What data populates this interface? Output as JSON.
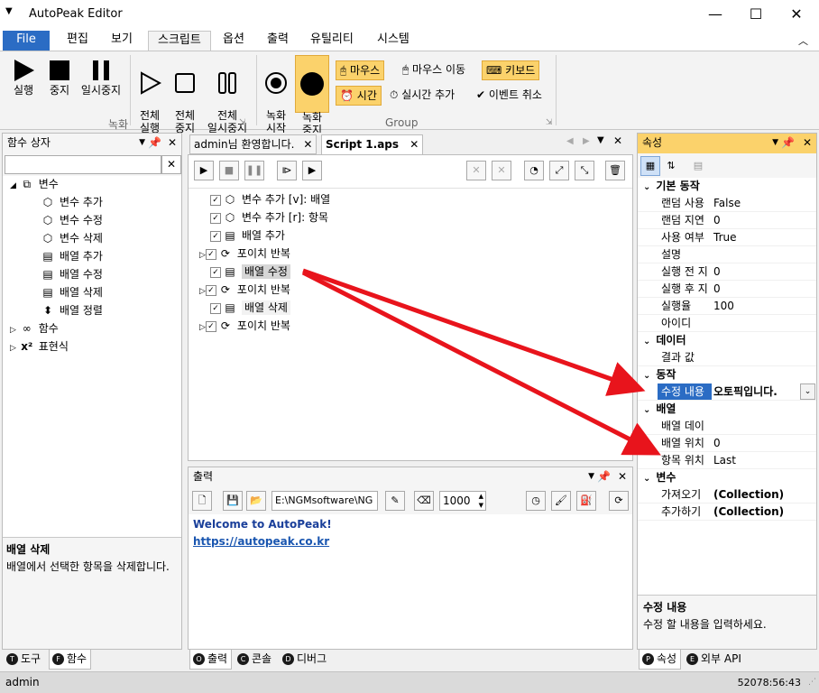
{
  "app": {
    "title": "AutoPeak Editor"
  },
  "menu": {
    "file": "File",
    "tabs": [
      "편집",
      "보기",
      "스크립트",
      "옵션",
      "출력",
      "유틸리티",
      "시스템"
    ]
  },
  "ribbon": {
    "run": "실행",
    "stop": "중지",
    "pause": "일시중지",
    "run_all": "전체\n실행",
    "stop_all": "전체\n중지",
    "pause_all": "전체\n일시중지",
    "rec_start": "녹화\n시작",
    "rec_stop": "녹화\n중지",
    "mouse": "마우스",
    "mouse_move": "마우스 이동",
    "keyboard": "키보드",
    "time": "시간",
    "realtime_add": "실시간 추가",
    "event_cancel": "이벤트 취소",
    "group1_label": "녹화",
    "group2_label": "Group"
  },
  "toolbox": {
    "title": "함수 상자",
    "tree": [
      {
        "label": "변수",
        "icon": "variable-icon"
      },
      {
        "label": "변수 추가",
        "icon": "cube-icon"
      },
      {
        "label": "변수 수정",
        "icon": "cube-icon"
      },
      {
        "label": "변수 삭제",
        "icon": "cube-icon"
      },
      {
        "label": "배열 추가",
        "icon": "list-icon"
      },
      {
        "label": "배열 수정",
        "icon": "list-icon"
      },
      {
        "label": "배열 삭제",
        "icon": "list-icon"
      },
      {
        "label": "배열 정렬",
        "icon": "sort-icon"
      },
      {
        "label": "함수",
        "icon": "infinity-icon"
      },
      {
        "label": "표현식",
        "icon": "x-squared-icon"
      }
    ],
    "desc_title": "배열 삭제",
    "desc_text": "배열에서 선택한 항목을 삭제합니다.",
    "bottom_tabs": [
      "도구",
      "함수"
    ]
  },
  "editor": {
    "tabs": [
      "admin님 환영합니다.",
      "Script 1.aps"
    ],
    "lines": [
      {
        "text": "변수 추가 [v]: 배열",
        "expand": false
      },
      {
        "text": "변수 추가 [r]: 항목",
        "expand": false
      },
      {
        "text": "배열 추가",
        "expand": false
      },
      {
        "text": "포이치 반복",
        "expand": true
      },
      {
        "text": "배열 수정",
        "expand": false
      },
      {
        "text": "포이치 반복",
        "expand": true
      },
      {
        "text": "배열 삭제",
        "expand": false
      },
      {
        "text": "포이치 반복",
        "expand": true
      }
    ]
  },
  "output": {
    "title": "출력",
    "path": "E:\\NGMsoftware\\NG",
    "interval": "1000",
    "welcome": "Welcome to AutoPeak!",
    "link": "https://autopeak.co.kr",
    "bottom_tabs": [
      "출력",
      "콘솔",
      "디버그"
    ]
  },
  "properties": {
    "title": "속성",
    "categories": [
      {
        "name": "기본 동작",
        "rows": [
          {
            "k": "랜덤 사용",
            "v": "False"
          },
          {
            "k": "랜덤 지연",
            "v": "0"
          },
          {
            "k": "사용 여부",
            "v": "True"
          },
          {
            "k": "설명",
            "v": ""
          },
          {
            "k": "실행 전 지",
            "v": "0"
          },
          {
            "k": "실행 후 지",
            "v": "0"
          },
          {
            "k": "실행율",
            "v": "100"
          },
          {
            "k": "아이디",
            "v": ""
          }
        ]
      },
      {
        "name": "데이터",
        "rows": [
          {
            "k": "결과 값",
            "v": ""
          }
        ]
      },
      {
        "name": "동작",
        "rows": [
          {
            "k": "수정 내용",
            "v": "오토픽입니다."
          }
        ]
      },
      {
        "name": "배열",
        "rows": [
          {
            "k": "배열 데이",
            "v": ""
          },
          {
            "k": "배열 위치",
            "v": "0"
          },
          {
            "k": "항목 위치",
            "v": "Last"
          }
        ]
      },
      {
        "name": "변수",
        "rows": [
          {
            "k": "가져오기",
            "v": "(Collection)"
          },
          {
            "k": "추가하기",
            "v": "(Collection)"
          }
        ]
      }
    ],
    "desc_title": "수정 내용",
    "desc_text": "수정 할 내용을 입력하세요.",
    "bottom_tabs": [
      "속성",
      "외부 API"
    ]
  },
  "status": {
    "user": "admin",
    "clock": "52078:56:43"
  },
  "colors": {
    "accent": "#2b6cc4",
    "highlight": "#fbd26b",
    "arrow": "#e8141c",
    "link": "#1a56b0"
  }
}
